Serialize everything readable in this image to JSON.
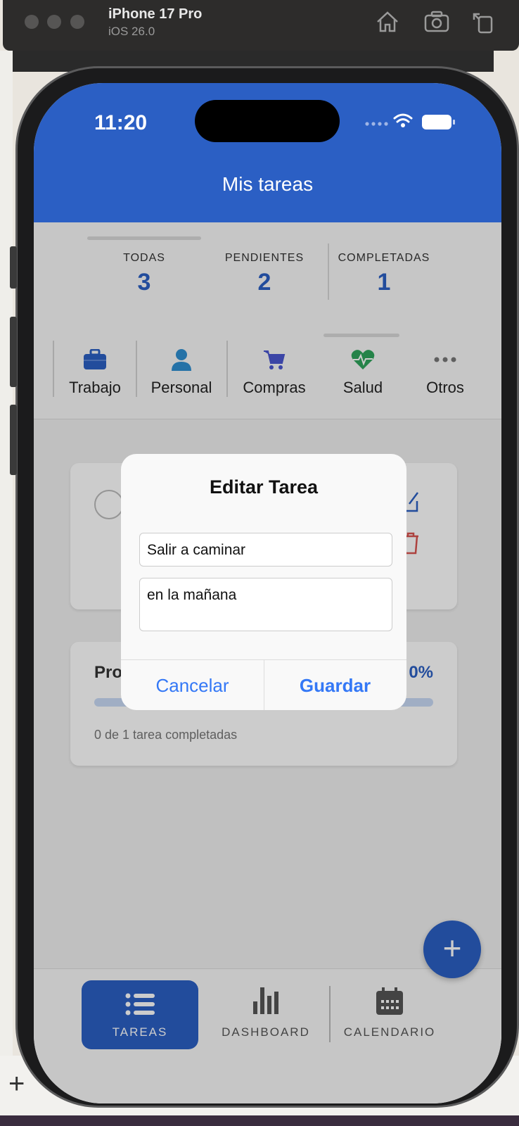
{
  "simulator": {
    "device_name": "iPhone 17 Pro",
    "os_version": "iOS 26.0"
  },
  "status_bar": {
    "time": "11:20"
  },
  "header": {
    "title": "Mis tareas"
  },
  "stats": [
    {
      "label": "TODAS",
      "value": "3"
    },
    {
      "label": "PENDIENTES",
      "value": "2"
    },
    {
      "label": "COMPLETADAS",
      "value": "1"
    }
  ],
  "categories": [
    {
      "label": "Trabajo",
      "icon": "briefcase-icon",
      "color": "#2b5fc4"
    },
    {
      "label": "Personal",
      "icon": "person-icon",
      "color": "#2f8fd1"
    },
    {
      "label": "Compras",
      "icon": "cart-icon",
      "color": "#4a57d0"
    },
    {
      "label": "Salud",
      "icon": "heart-pulse-icon",
      "color": "#2fa45c"
    },
    {
      "label": "Otros",
      "icon": "more-dots-icon",
      "color": "#777777"
    }
  ],
  "progress": {
    "title": "Pro",
    "percent_text": "0%",
    "percent": 0,
    "summary": "0 de 1 tarea completadas"
  },
  "tabs": [
    {
      "label": "TAREAS",
      "icon": "list-icon",
      "active": true
    },
    {
      "label": "DASHBOARD",
      "icon": "bar-chart-icon",
      "active": false
    },
    {
      "label": "CALENDARIO",
      "icon": "calendar-icon",
      "active": false
    }
  ],
  "fab": {
    "icon": "plus-icon",
    "label": "+"
  },
  "dialog": {
    "title": "Editar Tarea",
    "title_value": "Salir a caminar",
    "description_value": "en la mañana",
    "cancel_label": "Cancelar",
    "save_label": "Guardar"
  },
  "colors": {
    "primary": "#2b5fc4",
    "ios_link": "#3478f6",
    "delete": "#d9534f"
  }
}
